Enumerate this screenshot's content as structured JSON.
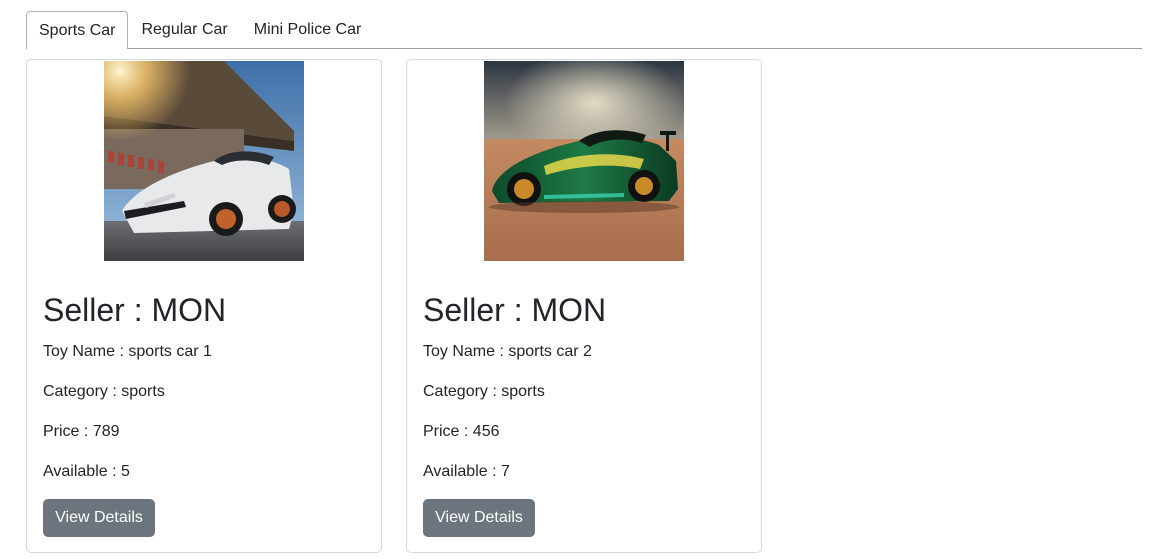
{
  "tabs": [
    {
      "label": "Sports Car",
      "active": true
    },
    {
      "label": "Regular Car",
      "active": false
    },
    {
      "label": "Mini Police Car",
      "active": false
    }
  ],
  "cards": [
    {
      "image_alt": "white sports car at race track",
      "seller_label": "Seller : MON",
      "toy_name": "Toy Name : sports car 1",
      "category": "Category : sports",
      "price": "Price : 789",
      "available": "Available : 5",
      "button_label": "View Details"
    },
    {
      "image_alt": "green sports car in desert",
      "seller_label": "Seller : MON",
      "toy_name": "Toy Name : sports car 2",
      "category": "Category : sports",
      "price": "Price : 456",
      "available": "Available : 7",
      "button_label": "View Details"
    }
  ],
  "colors": {
    "button_bg": "#6c757d",
    "card_border": "#d6d9dc"
  }
}
